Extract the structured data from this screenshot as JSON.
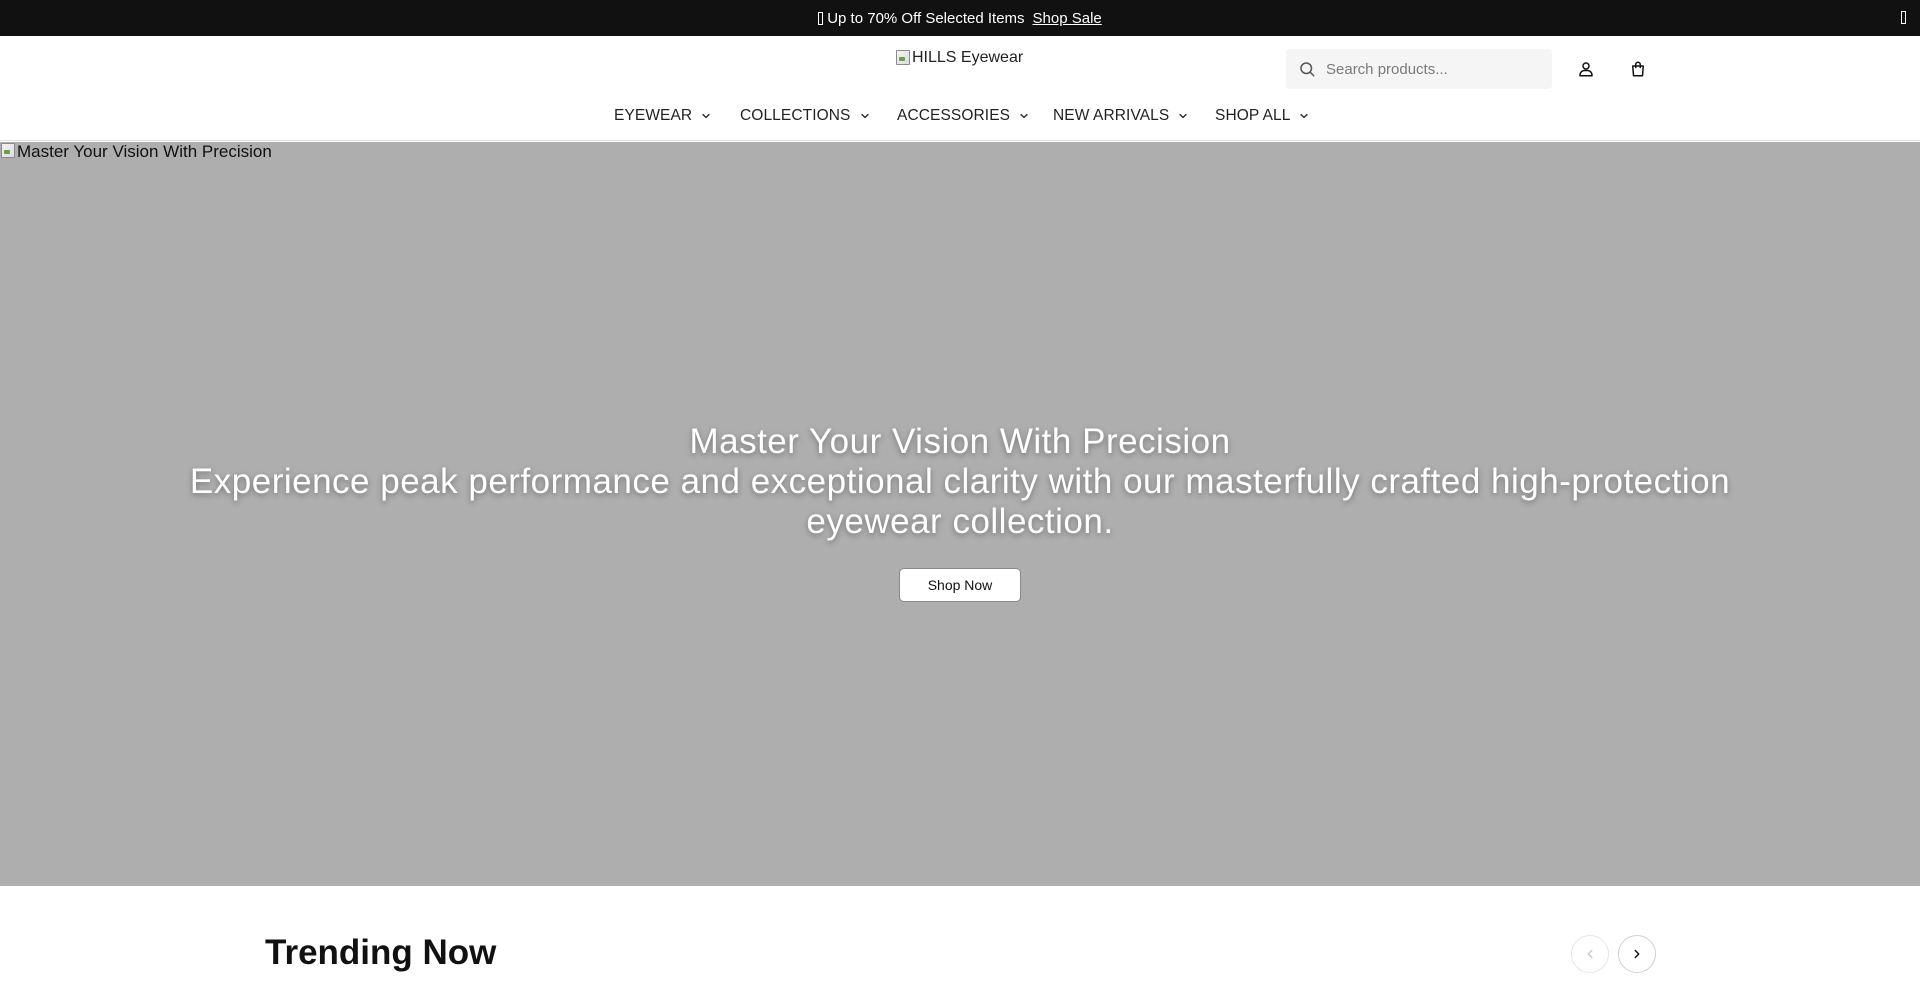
{
  "announcement": {
    "text": "Up to 70% Off Selected Items",
    "link_label": "Shop Sale"
  },
  "header": {
    "logo_alt": "HILLS Eyewear",
    "search": {
      "placeholder": "Search products..."
    },
    "icons": {
      "search": "search-icon",
      "account": "user-icon",
      "cart": "shopping-bag-icon"
    },
    "nav": [
      {
        "label": "EYEWEAR"
      },
      {
        "label": "COLLECTIONS"
      },
      {
        "label": "ACCESSORIES"
      },
      {
        "label": "NEW ARRIVALS"
      },
      {
        "label": "SHOP ALL"
      }
    ]
  },
  "hero": {
    "image_alt": "Master Your Vision With Precision",
    "title": "Master Your Vision With Precision",
    "subtitle": "Experience peak performance and exceptional clarity with our masterfully crafted high-protection eyewear collection.",
    "cta_label": "Shop Now",
    "background_color": "#aeaeae"
  },
  "trending": {
    "title": "Trending Now"
  },
  "colors": {
    "announcement_bg": "#111111",
    "accent": "#111111"
  }
}
